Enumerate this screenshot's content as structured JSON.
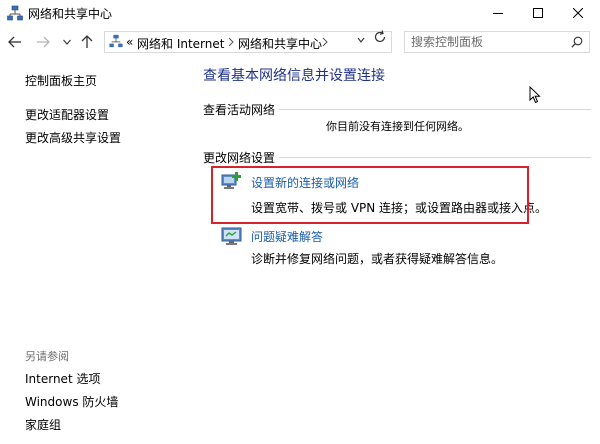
{
  "window": {
    "title": "网络和共享中心"
  },
  "address_bar": {
    "overflow": "«",
    "crumbs": [
      "网络和 Internet",
      "网络和共享中心"
    ]
  },
  "search": {
    "placeholder": "搜索控制面板"
  },
  "sidebar": {
    "links": [
      "控制面板主页",
      "更改适配器设置",
      "更改高级共享设置"
    ],
    "see_also_title": "另请参阅",
    "see_also_links": [
      "Internet 选项",
      "Windows 防火墙",
      "家庭组"
    ]
  },
  "main": {
    "title": "查看基本网络信息并设置连接",
    "active_networks_title": "查看活动网络",
    "no_network_message": "你目前没有连接到任何网络。",
    "change_settings_title": "更改网络设置",
    "tasks": [
      {
        "link": "设置新的连接或网络",
        "description": "设置宽带、拨号或 VPN 连接；或设置路由器或接入点。",
        "icon": "new-connection-icon"
      },
      {
        "link": "问题疑难解答",
        "description": "诊断并修复网络问题，或者获得疑难解答信息。",
        "icon": "troubleshoot-icon"
      }
    ]
  },
  "colors": {
    "page_title": "#1e3287",
    "link": "#1a5ca9",
    "highlight": "#d9232b",
    "see_also": "#6d6d6d"
  }
}
